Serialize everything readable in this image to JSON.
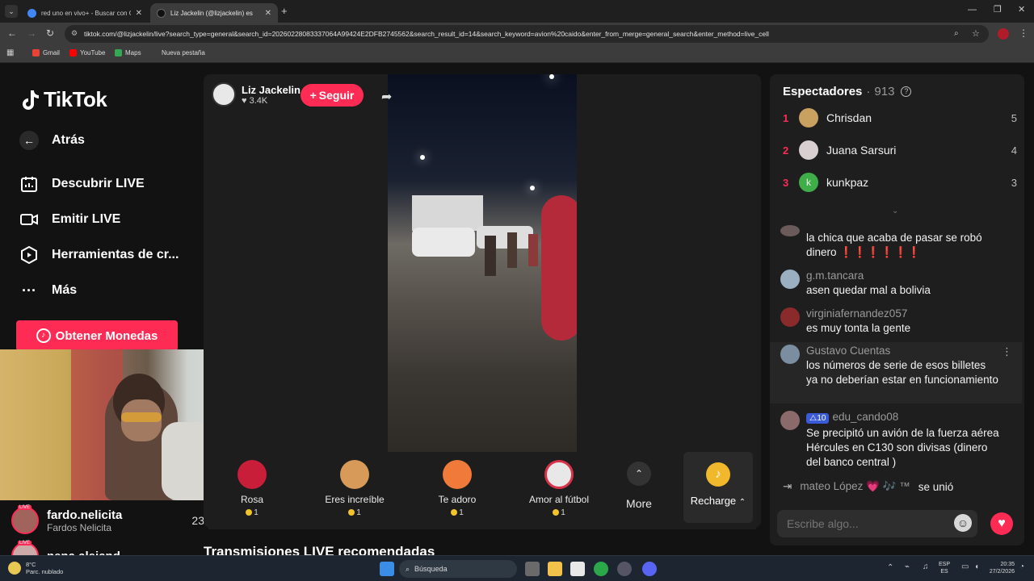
{
  "browser": {
    "tabs": [
      {
        "title": "red uno en vivo+ - Buscar con Google",
        "active": false
      },
      {
        "title": "Liz Jackelin (@lizjackelin) es",
        "active": true
      }
    ],
    "url": "tiktok.com/@lizjackelin/live?search_type=general&search_id=20260228083337064A99424E2DFB2745562&search_result_id=14&search_keyword=avion%20caido&enter_from_merge=general_search&enter_method=live_cell",
    "bookmarks": [
      "Gmail",
      "YouTube",
      "Maps",
      "Nueva pestaña"
    ]
  },
  "sidebar": {
    "logo": "TikTok",
    "back": "Atrás",
    "items": [
      "Descubrir LIVE",
      "Emitir LIVE",
      "Herramientas de cr...",
      "Más"
    ],
    "coins_button": "Obtener Monedas",
    "recommended": [
      {
        "name": "fardo.nelicita",
        "subtitle": "Fardos Nelicita",
        "count": "23"
      },
      {
        "name": "nena.alejand",
        "subtitle": "",
        "count": ""
      }
    ],
    "live_badge": "LIVE"
  },
  "player": {
    "host_name": "Liz Jackelin",
    "likes": "3.4K",
    "follow_label": "Seguir",
    "gifts": [
      {
        "name": "Rosa",
        "cost": "1"
      },
      {
        "name": "Eres increíble",
        "cost": "1"
      },
      {
        "name": "Te adoro",
        "cost": "1"
      },
      {
        "name": "Amor al fútbol",
        "cost": "1"
      }
    ],
    "more_label": "More",
    "recharge_label": "Recharge"
  },
  "recommended_title": "Transmisiones LIVE recomendadas",
  "viewers": {
    "title": "Espectadores",
    "count": "913",
    "top": [
      {
        "rank": "1",
        "name": "Chrisdan",
        "score": "5"
      },
      {
        "rank": "2",
        "name": "Juana Sarsuri",
        "score": "4"
      },
      {
        "rank": "3",
        "name": "kunkpaz",
        "score": "3"
      }
    ]
  },
  "chat": {
    "comments": [
      {
        "user": "",
        "text": "la chica que acaba de pasar se robó dinero ❗❗❗❗❗❗"
      },
      {
        "user": "g.m.tancara",
        "text": "asen quedar mal a bolivia"
      },
      {
        "user": "virginiafernandez057",
        "text": "es muy tonta la gente"
      },
      {
        "user": "Gustavo Cuentas",
        "text": "los números de serie de esos billetes ya no deberían estar en funcionamiento"
      },
      {
        "user": "edu_cando08",
        "badge": "10",
        "text": "Se precipitó un avión de la fuerza aérea Hércules en C130 son divisas (dinero del banco central )"
      }
    ],
    "join": {
      "user": "mateo López 💗 🎶 ™",
      "text": "se unió"
    },
    "placeholder": "Escribe algo..."
  },
  "taskbar": {
    "weather_temp": "8°C",
    "weather_desc": "Parc. nublado",
    "search": "Búsqueda",
    "lang_top": "ESP",
    "lang_bottom": "ES",
    "time": "20:35",
    "date": "27/2/2026"
  },
  "colors": {
    "accent": "#fe2c55",
    "panel": "#1e1e1e",
    "background": "#121212"
  }
}
